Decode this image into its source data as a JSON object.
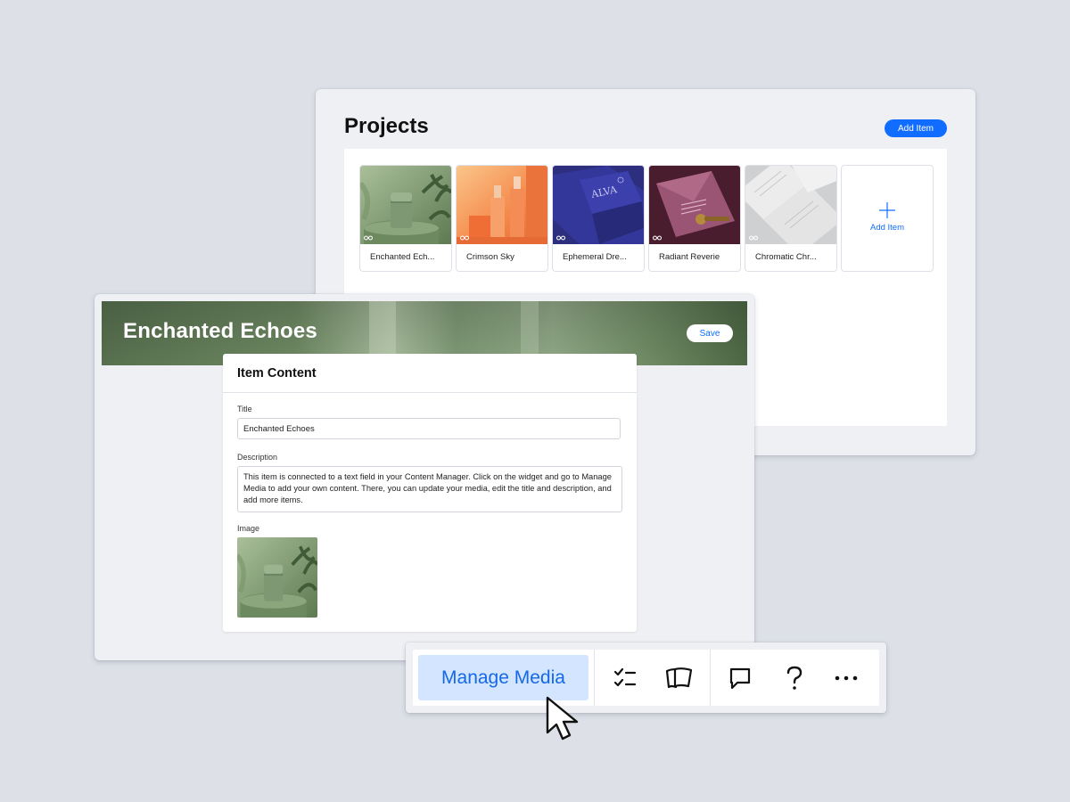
{
  "projects": {
    "title": "Projects",
    "add_item_label": "Add Item",
    "items": [
      {
        "label": "Enchanted Ech...",
        "thumb": "green-cosmetic-jar"
      },
      {
        "label": "Crimson Sky",
        "thumb": "orange-bottles"
      },
      {
        "label": "Ephemeral Dre...",
        "thumb": "blue-alva-box"
      },
      {
        "label": "Radiant Reverie",
        "thumb": "plum-envelope"
      },
      {
        "label": "Chromatic Chr...",
        "thumb": "grey-paper-sheets"
      }
    ],
    "add_card_label": "Add Item"
  },
  "editor": {
    "hero_title": "Enchanted Echoes",
    "save_label": "Save",
    "section_title": "Item Content",
    "title_label": "Title",
    "title_value": "Enchanted Echoes",
    "description_label": "Description",
    "description_value": "This item is connected to a text field in your Content Manager. Click on the widget and go to Manage Media to add your own content. There, you can update your media, edit the title and description, and add more items.",
    "image_label": "Image"
  },
  "toolbar": {
    "manage_media_label": "Manage Media",
    "icons": [
      "checklist-icon",
      "cards-icon",
      "comment-icon",
      "help-icon",
      "more-icon"
    ]
  },
  "colors": {
    "accent": "#116dff",
    "manage_media_bg": "#d4e5ff",
    "background": "#dde0e7"
  }
}
